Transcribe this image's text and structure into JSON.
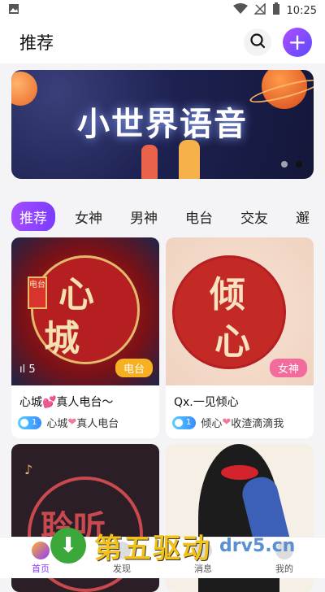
{
  "status_bar": {
    "time": "10:25",
    "icons": [
      "image-icon",
      "wifi-icon",
      "no-signal-icon",
      "battery-icon"
    ]
  },
  "header": {
    "title": "推荐",
    "search_icon": "search-icon",
    "add_icon": "plus-icon"
  },
  "banner": {
    "text": "小世界语音",
    "dot_count": 2,
    "active_dot": 1
  },
  "tabs": [
    {
      "label": "推荐",
      "active": true
    },
    {
      "label": "女神",
      "active": false
    },
    {
      "label": "男神",
      "active": false
    },
    {
      "label": "电台",
      "active": false
    },
    {
      "label": "交友",
      "active": false
    },
    {
      "label": "邂",
      "active": false
    }
  ],
  "rooms": [
    {
      "cover_chars": [
        "心",
        "城"
      ],
      "seal_text": "电台",
      "listeners": "5",
      "category": "电台",
      "name": "心城💕真人电台〜",
      "level": "1",
      "owner": "心城",
      "owner_suffix": "真人电台"
    },
    {
      "cover_chars": [
        "倾",
        "心"
      ],
      "listeners": "",
      "category": "女神",
      "name": "Qx.一见倾心",
      "level": "1",
      "owner": "倾心",
      "owner_suffix": "收渣滴滴我"
    },
    {
      "cover_text": "聆听"
    },
    {}
  ],
  "bottom_nav": [
    {
      "label": "首页",
      "icon": "home-planet-icon",
      "active": true
    },
    {
      "label": "发现",
      "icon": "discover-icon",
      "active": false
    },
    {
      "label": "消息",
      "icon": "message-icon",
      "active": false
    },
    {
      "label": "我的",
      "icon": "profile-icon",
      "active": false
    }
  ],
  "watermark": {
    "text": "第五驱动",
    "url": "drv5.cn"
  },
  "colors": {
    "accent": "#8c3cff",
    "radio_badge": "#f6b022",
    "goddess_badge": "#f36a9c"
  }
}
